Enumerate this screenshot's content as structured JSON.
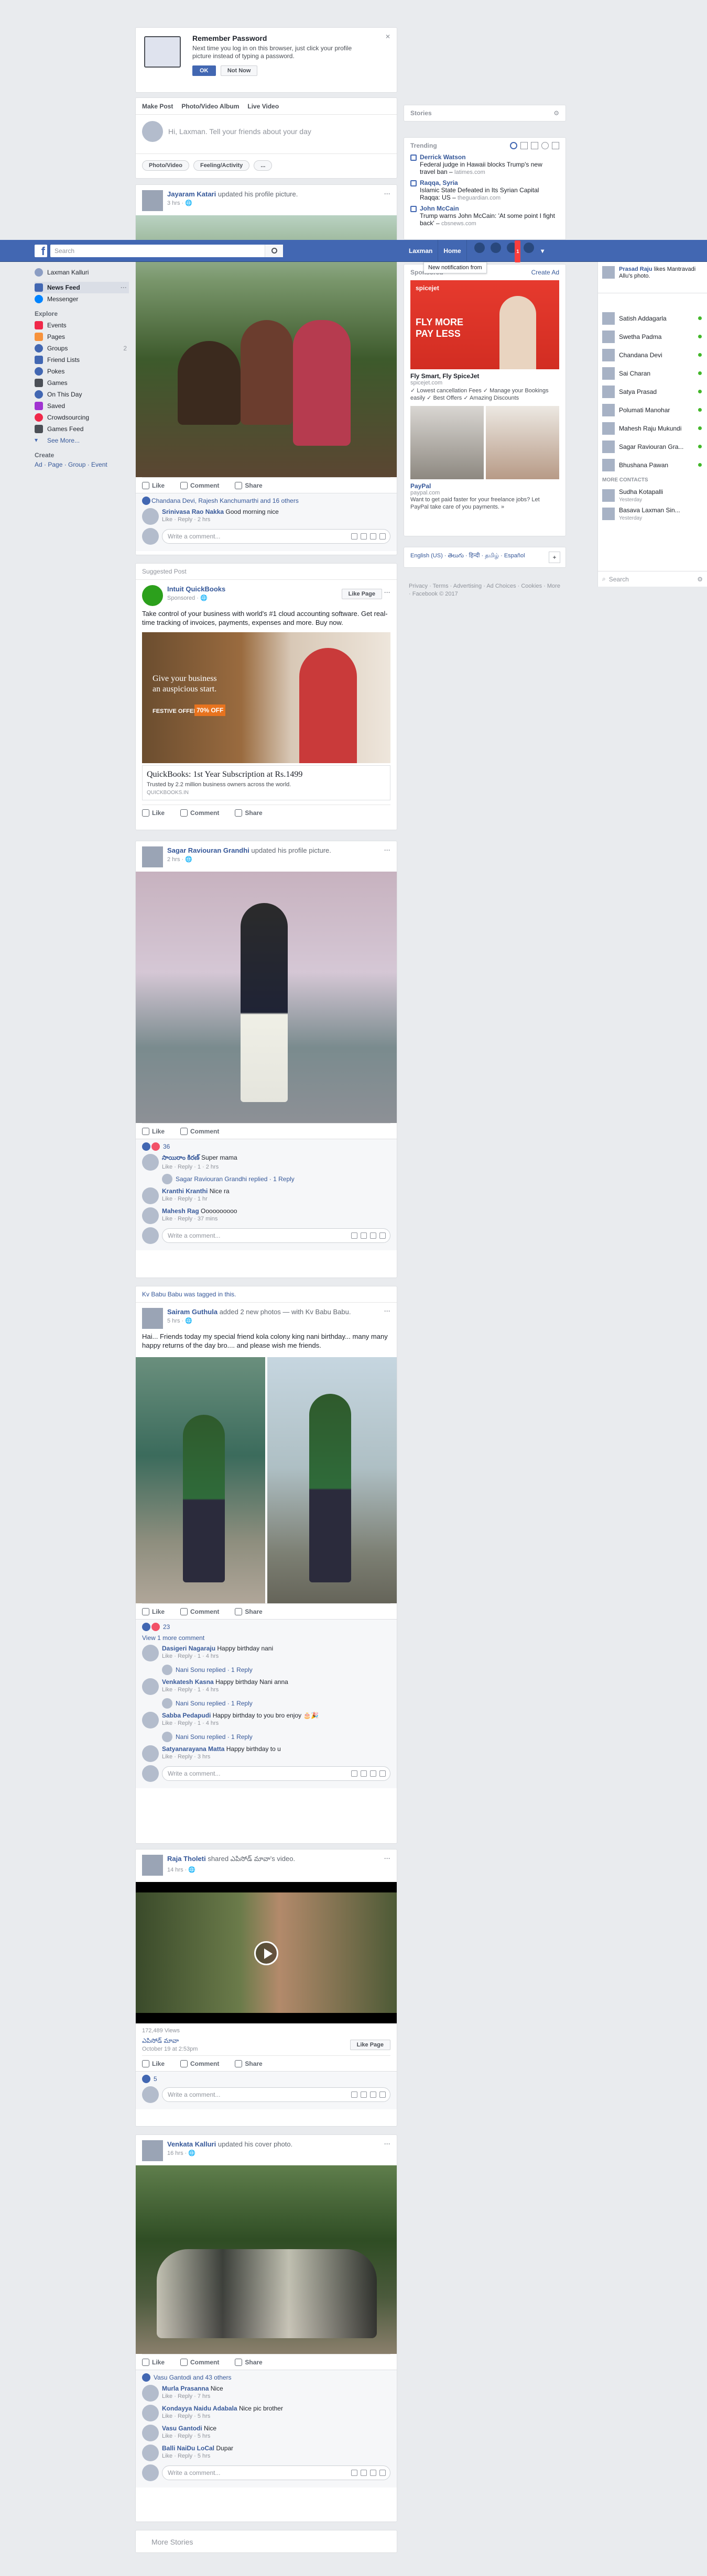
{
  "topbar": {
    "logo": "f",
    "search_placeholder": "Search",
    "user": "Laxman",
    "home": "Home",
    "notif_badge": "1",
    "tooltip": "New notification from"
  },
  "reminder": {
    "title": "Remember Password",
    "body": "Next time you log in on this browser, just click your profile picture instead of typing a password.",
    "ok": "OK",
    "not_now": "Not Now"
  },
  "composer": {
    "tabs": [
      "Make Post",
      "Photo/Video Album",
      "Live Video"
    ],
    "placeholder": "Hi, Laxman. Tell your friends about your day",
    "chips": [
      "Photo/Video",
      "Feeling/Activity",
      "..."
    ]
  },
  "left": {
    "me": "Laxman Kalluri",
    "items": [
      {
        "label": "News Feed",
        "active": true,
        "color": "#4267b2"
      },
      {
        "label": "Messenger",
        "color": "#0084ff"
      }
    ],
    "explore_head": "Explore",
    "explore": [
      {
        "label": "Events",
        "color": "#f02849"
      },
      {
        "label": "Pages",
        "color": "#f7923b"
      },
      {
        "label": "Groups",
        "color": "#4267b2"
      },
      {
        "label": "Friend Lists",
        "color": "#4267b2"
      },
      {
        "label": "Pokes",
        "color": "#4267b2"
      },
      {
        "label": "Games",
        "color": "#4b4f56"
      },
      {
        "label": "On This Day",
        "color": "#4267b2"
      },
      {
        "label": "Saved",
        "color": "#a033d1"
      },
      {
        "label": "Crowdsourcing",
        "color": "#f02849"
      },
      {
        "label": "Games Feed",
        "color": "#4b4f56"
      }
    ],
    "see_more": "See More...",
    "create_head": "Create",
    "create_links": "Ad · Page · Group · Event"
  },
  "posts": {
    "p1": {
      "name": "Jayaram Katari",
      "action": "updated his profile picture.",
      "time": "3 hrs",
      "reactions": "Chandana Devi, Rajesh Kanchumarthi and 16 others",
      "comment": {
        "name": "Srinivasa Rao Nakka",
        "text": "Good morning nice",
        "links": "Like · Reply · 2 hrs"
      },
      "actions": [
        "Like",
        "Comment",
        "Share"
      ],
      "write": "Write a comment..."
    },
    "ad": {
      "header": "Suggested Post",
      "name": "Intuit QuickBooks",
      "sponsored": "Sponsored",
      "like_page": "Like Page",
      "text": "Take control of your business with world's #1 cloud accounting software. Get real-time tracking of invoices, payments, expenses and more. Buy now.",
      "img_line1": "Give your business",
      "img_line2": "an auspicious start.",
      "img_festive": "FESTIVE OFFER",
      "img_pct": "70% OFF",
      "title": "QuickBooks: 1st Year Subscription at Rs.1499",
      "desc": "Trusted by 2.2 million business owners across the world.",
      "domain": "QUICKBOOKS.IN",
      "actions": [
        "Like",
        "Comment",
        "Share"
      ]
    },
    "p2": {
      "name": "Sagar Raviouran Grandhi",
      "action": "updated his profile picture.",
      "time": "2 hrs",
      "actions": [
        "Like",
        "Comment"
      ],
      "react_count": "36",
      "comments": [
        {
          "name": "సాయిరాం కిరణ్",
          "text": "Super mama",
          "links": "Like · Reply · 1 · 2 hrs"
        },
        {
          "name": "Kranthi Kranthi",
          "text": "Nice ra",
          "links": "Like · Reply · 1 hr"
        },
        {
          "name": "Mahesh Rag",
          "text": "Oooooooooo",
          "links": "Like · Reply · 37 mins"
        }
      ],
      "reply": "Sagar Raviouran Grandhi replied · 1 Reply",
      "write": "Write a comment..."
    },
    "p3": {
      "tagged_line": "Kv Babu Babu was tagged in this.",
      "name": "Sairam Guthula",
      "action": "added 2 new photos — with Kv Babu Babu.",
      "time": "5 hrs",
      "text": "Hai... Friends today my special friend kola colony king nani birthday... many many happy returns of the day bro.... and please wish me friends.",
      "actions": [
        "Like",
        "Comment",
        "Share"
      ],
      "react_count": "23",
      "view_more": "View 1 more comment",
      "comments": [
        {
          "name": "Dasigeri Nagaraju",
          "text": "Happy birthday nani",
          "links": "Like · Reply · 1 · 4 hrs",
          "reply": "Nani Sonu replied · 1 Reply"
        },
        {
          "name": "Venkatesh Kasna",
          "text": "Happy birthday Nani anna",
          "links": "Like · Reply · 1 · 4 hrs",
          "reply": "Nani Sonu replied · 1 Reply"
        },
        {
          "name": "Sabba Pedapudi",
          "text": "Happy birthday to you bro enjoy 🎂🎉",
          "links": "Like · Reply · 1 · 4 hrs",
          "reply": "Nani Sonu replied · 1 Reply"
        },
        {
          "name": "Satyanarayana Matta",
          "text": "Happy birthday to u",
          "links": "Like · Reply · 3 hrs"
        }
      ],
      "write": "Write a comment..."
    },
    "p4": {
      "name": "Raja Tholeti",
      "action": "shared ఎపిసోడ్ మావా's video.",
      "time": "14 hrs",
      "views": "172,489 Views",
      "page_name": "ఎపిసోడ్ మావా",
      "date": "October 19 at 2:53pm",
      "like_page": "Like Page",
      "actions": [
        "Like",
        "Comment",
        "Share"
      ],
      "react_count": "5",
      "write": "Write a comment..."
    },
    "p5": {
      "name": "Venkata Kalluri",
      "action": "updated his cover photo.",
      "time": "16 hrs",
      "actions": [
        "Like",
        "Comment",
        "Share"
      ],
      "reactions": "Vasu Gantodi and 43 others",
      "comments": [
        {
          "name": "Murla Prasanna",
          "text": "Nice",
          "links": "Like · Reply · 7 hrs"
        },
        {
          "name": "Kondayya Naidu Adabala",
          "text": "Nice pic brother",
          "links": "Like · Reply · 5 hrs"
        },
        {
          "name": "Vasu Gantodi",
          "text": "Nice",
          "links": "Like · Reply · 5 hrs"
        },
        {
          "name": "Balli NaiDu LoCal",
          "text": "Dupar",
          "links": "Like · Reply · 5 hrs"
        }
      ],
      "write": "Write a comment..."
    }
  },
  "more_stories": "More Stories",
  "right": {
    "stories_title": "Stories",
    "trending_title": "Trending",
    "trending": [
      {
        "name": "Derrick Watson",
        "text": "Federal judge in Hawaii blocks Trump's new travel ban",
        "src": "latimes.com"
      },
      {
        "name": "Raqqa, Syria",
        "text": "Islamic State Defeated in Its Syrian Capital Raqqa: US",
        "src": "theguardian.com"
      },
      {
        "name": "John McCain",
        "text": "Trump warns John McCain: 'At some point I fight back'",
        "src": "cbsnews.com"
      }
    ],
    "sponsored": "Sponsored",
    "create_ad": "Create Ad",
    "ad1_banner1": "spicejet",
    "ad1_banner2": "FLY MORE",
    "ad1_banner3": "PAY LESS",
    "ad1_title": "Fly Smart, Fly SpiceJet",
    "ad1_url": "spicejet.com",
    "ad1_desc": "✓ Lowest cancellation Fees ✓ Manage your Bookings easily ✓ Best Offers ✓ Amazing Discounts",
    "ad2_title": "PayPal",
    "ad2_url": "paypal.com",
    "ad2_desc": "Want to get paid faster for your freelance jobs? Let PayPal take care of you payments. »",
    "lang_line": "English (US) · తెలుగు · हिन्दी · தமிழ் · Español",
    "footer": "Privacy · Terms · Advertising · Ad Choices · Cookies · More · Facebook © 2017"
  },
  "chat": {
    "top": {
      "name": "Prasad Raju",
      "text": "likes Mantravadi Allu's photo."
    },
    "contacts": [
      "Satish Addagarla",
      "Swetha Padma",
      "Chandana Devi",
      "Sai Charan",
      "Satya Prasad",
      "Polumati Manohar",
      "Mahesh Raju Mukundi",
      "Sagar Raviouran Gra...",
      "Bhushana Pawan"
    ],
    "more_head": "MORE CONTACTS",
    "more": [
      {
        "name": "Sudha Kotapalli",
        "sub": "Yesterday"
      },
      {
        "name": "Basava Laxman Sin...",
        "sub": "Yesterday"
      }
    ],
    "search": "Search"
  }
}
